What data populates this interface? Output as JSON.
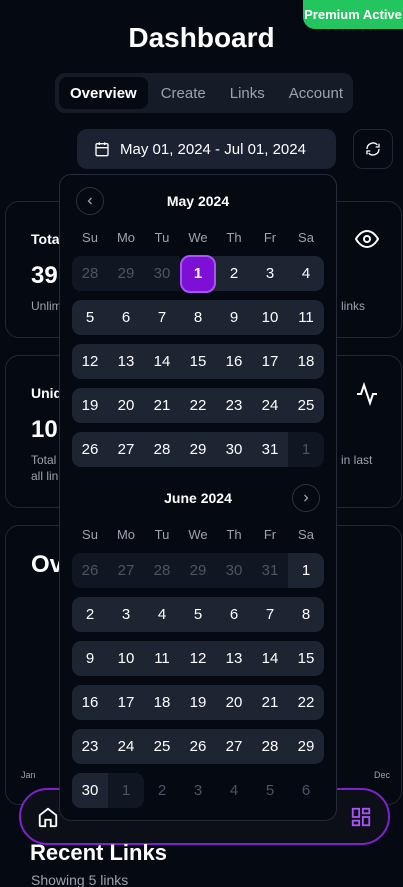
{
  "badge": "Premium Active",
  "title": "Dashboard",
  "tabs": [
    "Overview",
    "Create",
    "Links",
    "Account"
  ],
  "date_range": "May 01, 2024 - Jul 01, 2024",
  "cards": {
    "total_label": "Total",
    "total_value": "39",
    "total_sub_left": "Unlim",
    "total_sub_right": "links",
    "unique_label": "Uniq",
    "unique_value": "10",
    "unique_sub_left1": "Total",
    "unique_sub_left2": "all lin",
    "unique_sub_right": "in last",
    "overview_label": "Ov",
    "chart_start": "Jan",
    "chart_end": "Dec"
  },
  "calendar": {
    "weekdays": [
      "Su",
      "Mo",
      "Tu",
      "We",
      "Th",
      "Fr",
      "Sa"
    ],
    "month1": {
      "title": "May 2024",
      "leading": [
        "28",
        "29",
        "30"
      ],
      "rows": [
        [
          "",
          "",
          "",
          "1",
          "2",
          "3",
          "4"
        ],
        [
          "5",
          "6",
          "7",
          "8",
          "9",
          "10",
          "11"
        ],
        [
          "12",
          "13",
          "14",
          "15",
          "16",
          "17",
          "18"
        ],
        [
          "19",
          "20",
          "21",
          "22",
          "23",
          "24",
          "25"
        ],
        [
          "26",
          "27",
          "28",
          "29",
          "30",
          "31"
        ]
      ],
      "trailing": "1"
    },
    "month2": {
      "title": "June 2024",
      "leading": [
        "26",
        "27",
        "28",
        "29",
        "30",
        "31"
      ],
      "rows": [
        [
          "1"
        ],
        [
          "2",
          "3",
          "4",
          "5",
          "6",
          "7",
          "8"
        ],
        [
          "9",
          "10",
          "11",
          "12",
          "13",
          "14",
          "15"
        ],
        [
          "16",
          "17",
          "18",
          "19",
          "20",
          "21",
          "22"
        ],
        [
          "23",
          "24",
          "25",
          "26",
          "27",
          "28",
          "29"
        ],
        [
          "30"
        ]
      ],
      "trailing": [
        "1",
        "2",
        "3",
        "4",
        "5",
        "6"
      ]
    }
  },
  "recent": {
    "title": "Recent Links",
    "subtitle": "Showing 5 links"
  },
  "colors": {
    "accent": "#7e0fd4",
    "premium": "#22c55e",
    "background": "#050912"
  }
}
